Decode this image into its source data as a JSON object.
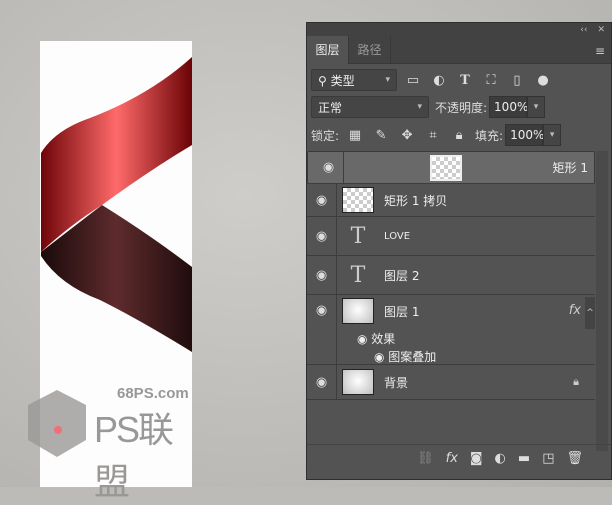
{
  "panel": {
    "tabs": [
      "图层",
      "路径"
    ],
    "collapse": "‹‹",
    "close": "✕",
    "menu": "≡"
  },
  "filter": {
    "label": "类型",
    "icons": [
      "image-filter",
      "adjustment-filter",
      "type-filter",
      "shape-filter",
      "smart-object-filter"
    ]
  },
  "blend": {
    "mode": "正常",
    "opacity_label": "不透明度:",
    "opacity": "100%"
  },
  "lock": {
    "label": "锁定:",
    "fill_label": "填充:",
    "fill": "100%"
  },
  "layers": [
    {
      "name": "矩形 1",
      "type": "shape",
      "selected": true
    },
    {
      "name": "矩形 1 拷贝",
      "type": "shape"
    },
    {
      "name": "LOVE",
      "type": "text"
    },
    {
      "name": "图层 2",
      "type": "text"
    },
    {
      "name": "图层 1",
      "type": "pixel",
      "fx": "fx",
      "effects_label": "效果",
      "effect": "图案叠加"
    },
    {
      "name": "背景",
      "type": "pixel",
      "locked": true
    }
  ],
  "watermark": {
    "url": "68PS.com",
    "name": "PS联盟"
  },
  "colors": {
    "red": "#e0464b",
    "dark": "#4a2022"
  }
}
